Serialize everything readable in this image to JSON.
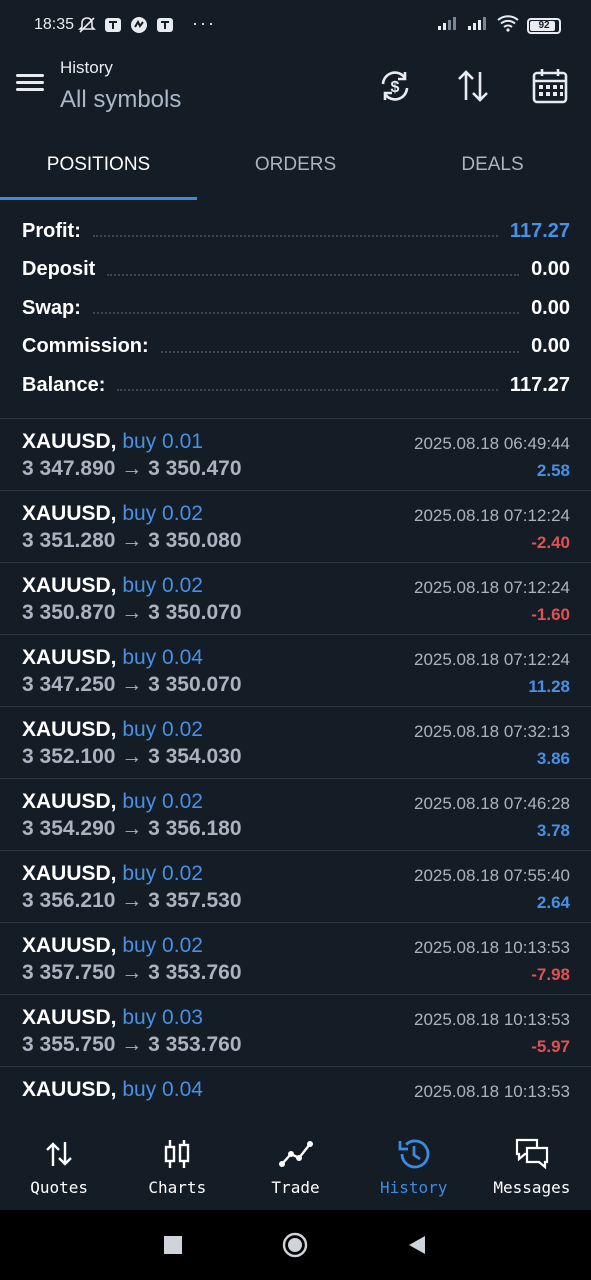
{
  "status_bar": {
    "time": "18:35",
    "more": "···",
    "battery": "92"
  },
  "header": {
    "title": "History",
    "subtitle": "All symbols",
    "icons": [
      "menu-icon",
      "currency-sync-icon",
      "sort-icon",
      "calendar-icon"
    ]
  },
  "tabs": [
    {
      "label": "POSITIONS",
      "active": true
    },
    {
      "label": "ORDERS",
      "active": false
    },
    {
      "label": "DEALS",
      "active": false
    }
  ],
  "summary": {
    "profit_label": "Profit:",
    "profit_value": "117.27",
    "deposit_label": "Deposit",
    "deposit_value": "0.00",
    "swap_label": "Swap:",
    "swap_value": "0.00",
    "commission_label": "Commission:",
    "commission_value": "0.00",
    "balance_label": "Balance:",
    "balance_value": "117.27"
  },
  "positions": [
    {
      "symbol": "XAUUSD,",
      "side": "buy 0.01",
      "prices": "3 347.890 → 3 350.470",
      "time": "2025.08.18 06:49:44",
      "pl": "2.58",
      "pl_sign": "pos"
    },
    {
      "symbol": "XAUUSD,",
      "side": "buy 0.02",
      "prices": "3 351.280 → 3 350.080",
      "time": "2025.08.18 07:12:24",
      "pl": "-2.40",
      "pl_sign": "neg"
    },
    {
      "symbol": "XAUUSD,",
      "side": "buy 0.02",
      "prices": "3 350.870 → 3 350.070",
      "time": "2025.08.18 07:12:24",
      "pl": "-1.60",
      "pl_sign": "neg"
    },
    {
      "symbol": "XAUUSD,",
      "side": "buy 0.04",
      "prices": "3 347.250 → 3 350.070",
      "time": "2025.08.18 07:12:24",
      "pl": "11.28",
      "pl_sign": "pos"
    },
    {
      "symbol": "XAUUSD,",
      "side": "buy 0.02",
      "prices": "3 352.100 → 3 354.030",
      "time": "2025.08.18 07:32:13",
      "pl": "3.86",
      "pl_sign": "pos"
    },
    {
      "symbol": "XAUUSD,",
      "side": "buy 0.02",
      "prices": "3 354.290 → 3 356.180",
      "time": "2025.08.18 07:46:28",
      "pl": "3.78",
      "pl_sign": "pos"
    },
    {
      "symbol": "XAUUSD,",
      "side": "buy 0.02",
      "prices": "3 356.210 → 3 357.530",
      "time": "2025.08.18 07:55:40",
      "pl": "2.64",
      "pl_sign": "pos"
    },
    {
      "symbol": "XAUUSD,",
      "side": "buy 0.02",
      "prices": "3 357.750 → 3 353.760",
      "time": "2025.08.18 10:13:53",
      "pl": "-7.98",
      "pl_sign": "neg"
    },
    {
      "symbol": "XAUUSD,",
      "side": "buy 0.03",
      "prices": "3 355.750 → 3 353.760",
      "time": "2025.08.18 10:13:53",
      "pl": "-5.97",
      "pl_sign": "neg"
    },
    {
      "symbol": "XAUUSD,",
      "side": "buy 0.04",
      "prices": "",
      "time": "2025.08.18 10:13:53",
      "pl": "",
      "pl_sign": "pos"
    }
  ],
  "bottom_nav": [
    {
      "label": "Quotes",
      "icon": "quotes-icon",
      "active": false
    },
    {
      "label": "Charts",
      "icon": "charts-icon",
      "active": false
    },
    {
      "label": "Trade",
      "icon": "trade-icon",
      "active": false
    },
    {
      "label": "History",
      "icon": "history-icon",
      "active": true
    },
    {
      "label": "Messages",
      "icon": "messages-icon",
      "active": false
    }
  ],
  "colors": {
    "background": "#141c26",
    "accent": "#3d8ae0",
    "positive": "#4a90e2",
    "negative": "#e05252",
    "muted": "#a9b4c0"
  }
}
